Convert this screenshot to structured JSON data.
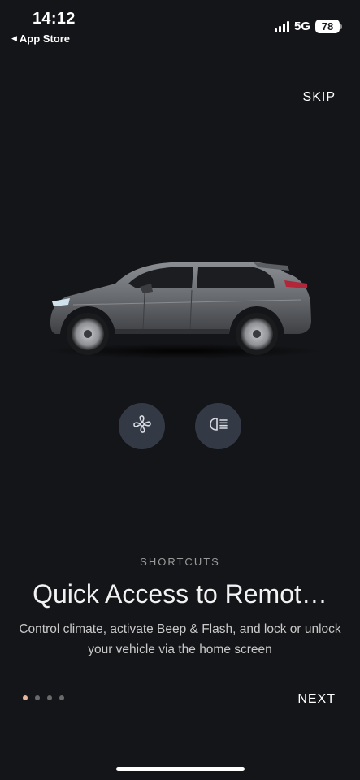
{
  "status_bar": {
    "time": "14:12",
    "back_app": "App Store",
    "network": "5G",
    "battery": "78"
  },
  "header": {
    "skip_label": "SKIP"
  },
  "shortcuts": {
    "buttons": [
      {
        "icon": "fan-icon"
      },
      {
        "icon": "headlight-icon"
      }
    ]
  },
  "content": {
    "section_label": "SHORTCUTS",
    "title": "Quick Access to Remot…",
    "description": "Control climate, activate Beep & Flash, and lock or unlock your vehicle via the home screen"
  },
  "pagination": {
    "total": 4,
    "active_index": 0
  },
  "footer": {
    "next_label": "NEXT"
  },
  "colors": {
    "background": "#141518",
    "button_bg": "#343a45",
    "active_dot": "#e8b49a",
    "inactive_dot": "#6a6a6a"
  }
}
